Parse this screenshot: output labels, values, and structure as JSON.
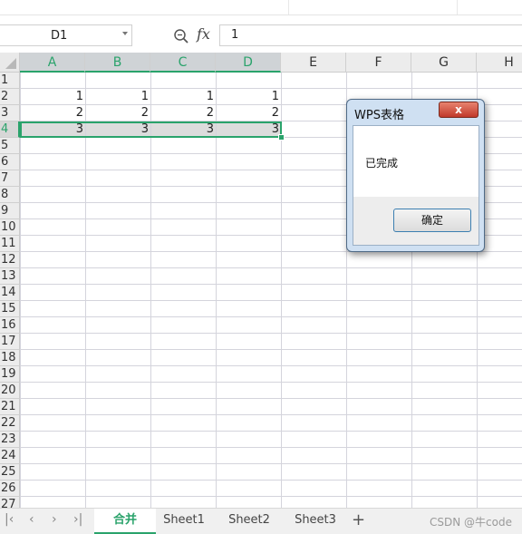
{
  "formula_bar": {
    "cell_ref": "D1",
    "formula_value": "1",
    "zoom_icon": "magnifier-icon",
    "fx_label": "fx"
  },
  "columns": [
    "A",
    "B",
    "C",
    "D",
    "E",
    "F",
    "G",
    "H"
  ],
  "selected_columns": [
    "A",
    "B",
    "C",
    "D"
  ],
  "rows": [
    "1",
    "2",
    "3",
    "4",
    "5",
    "6",
    "7",
    "8",
    "9",
    "10",
    "11",
    "12",
    "13",
    "14",
    "15",
    "16",
    "17",
    "18",
    "19",
    "20",
    "21",
    "22",
    "23",
    "24",
    "25",
    "26",
    "27"
  ],
  "selected_row": "4",
  "cells": {
    "A2": "1",
    "B2": "1",
    "C2": "1",
    "D2": "1",
    "A3": "2",
    "B3": "2",
    "C3": "2",
    "D3": "2",
    "A4": "3",
    "B4": "3",
    "C4": "3",
    "D4": "3"
  },
  "sheet_tabs": [
    {
      "label": "合并",
      "active": true
    },
    {
      "label": "Sheet1",
      "active": false
    },
    {
      "label": "Sheet2",
      "active": false
    },
    {
      "label": "Sheet3",
      "active": false
    }
  ],
  "add_sheet_label": "+",
  "watermark": "CSDN @牛code",
  "dialog": {
    "title": "WPS表格",
    "close_label": "x",
    "message": "已完成",
    "ok_label": "确定"
  },
  "colors": {
    "accent": "#2aa36b",
    "dialog_frame": "#cfe0f2",
    "close_button": "#c0392b"
  }
}
